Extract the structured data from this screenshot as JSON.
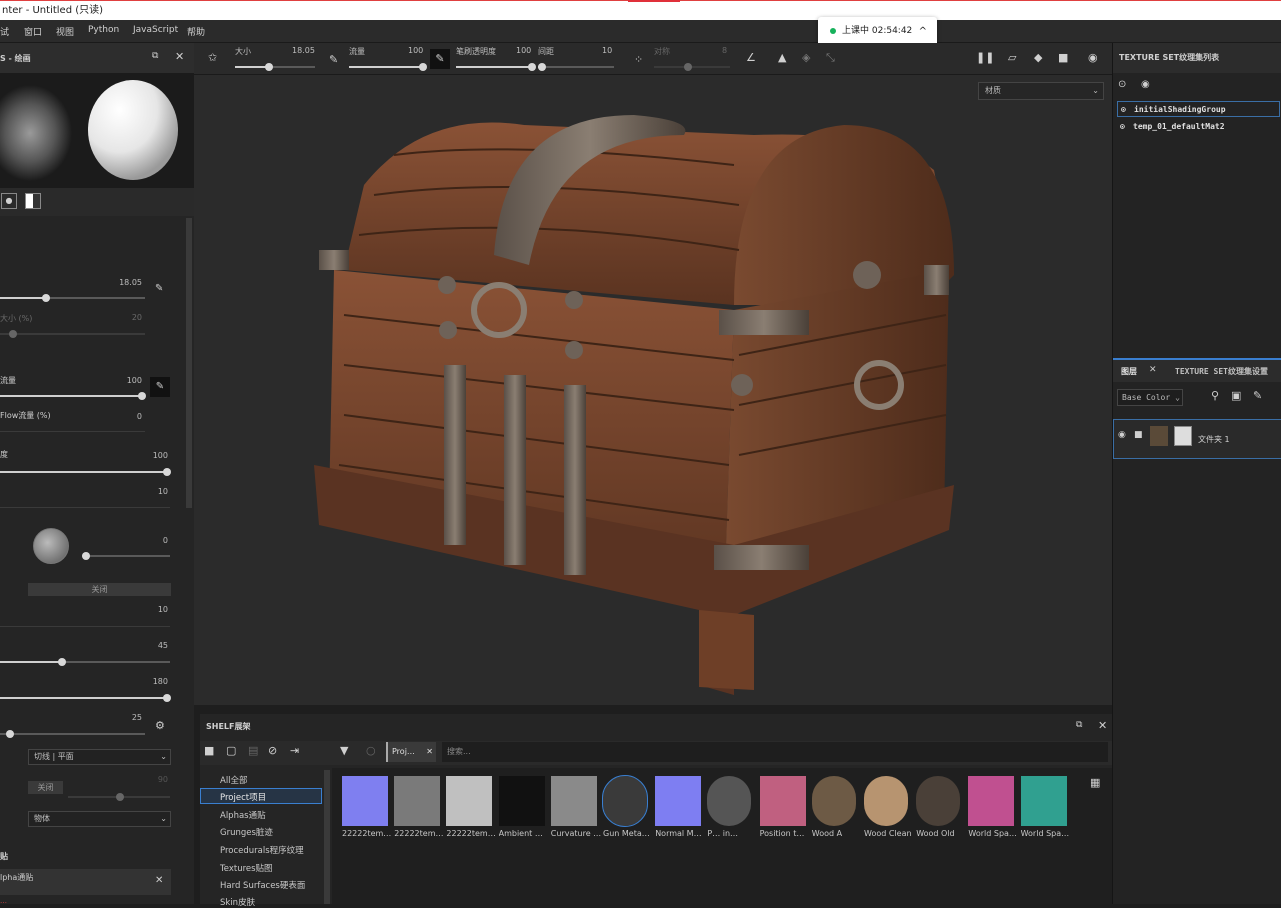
{
  "window": {
    "title": "nter - Untitled (只读)"
  },
  "menu": {
    "items": [
      "试",
      "窗口",
      "视图",
      "Python",
      "JavaScript",
      "帮助"
    ]
  },
  "live_badge": {
    "text": "上课中 02:54:42",
    "chevron": "^"
  },
  "left_panel": {
    "title": "S - 绘画",
    "rows": [
      {
        "label": "",
        "value": "18.05"
      },
      {
        "label": "大小 (%)",
        "value": "20"
      },
      {
        "label": "流量",
        "value": "100"
      },
      {
        "label": "Flow流量 (%)",
        "value": "0"
      },
      {
        "label": "度",
        "value": "100"
      },
      {
        "label": "",
        "value": "10"
      },
      {
        "label": "",
        "value": "0"
      },
      {
        "label": "",
        "value": "10"
      },
      {
        "label": "",
        "value": "45"
      },
      {
        "label": "",
        "value": "180"
      },
      {
        "label": "",
        "value": "25"
      }
    ],
    "close_button": "关闭",
    "mode_dropdown": "切线 | 平面",
    "close_button_2": "关闭",
    "dim_value": "90",
    "object_dropdown": "物体",
    "section_title": "贴",
    "alpha_item": "lpha通贴"
  },
  "toolbar": {
    "size_label": "大小",
    "size_value": "18.05",
    "flow_label": "流量",
    "flow_value": "100",
    "stroke_opacity_label": "笔刷透明度",
    "stroke_opacity_value": "100",
    "spacing_label": "间距",
    "spacing_value": "10",
    "sym_label": "对称",
    "sym_value": "8"
  },
  "viewport": {
    "material_dropdown": "材质"
  },
  "right_panel": {
    "texture_set_list_title": "TEXTURE SET纹理集列表",
    "texture_sets": [
      "initialShadingGroup",
      "temp_01_defaultMat2"
    ],
    "layers_tab": "图层",
    "texture_set_settings_tab": "TEXTURE SET纹理集设置",
    "channel_dropdown": "Base Color",
    "folder_layer_name": "文件夹 1"
  },
  "shelf": {
    "title": "SHELF展架",
    "filter_chip": "Proj…",
    "search_placeholder": "搜索...",
    "categories": [
      "All全部",
      "Project项目",
      "Alphas通贴",
      "Grunges脏迹",
      "Procedurals程序纹理",
      "Textures贴图",
      "Hard Surfaces硬表面",
      "Skin皮肤"
    ],
    "selected_category": "Project项目",
    "items": [
      {
        "label": "22222tem…",
        "color": "#7f7ff0"
      },
      {
        "label": "22222tem…",
        "color": "#7a7a7a"
      },
      {
        "label": "22222tem…",
        "color": "#c0c0c0"
      },
      {
        "label": "Ambient …",
        "color": "#111111"
      },
      {
        "label": "Curvature …",
        "color": "#8a8a8a"
      },
      {
        "label": "Gun Meta…",
        "color": "#3a3a3a"
      },
      {
        "label": "Normal M…",
        "color": "#7e7ef2"
      },
      {
        "label": "P… in…",
        "color": "#555555"
      },
      {
        "label": "Position t…",
        "color": "#c06080"
      },
      {
        "label": "Wood A",
        "color": "#6d5a45"
      },
      {
        "label": "Wood Clean",
        "color": "#b79470"
      },
      {
        "label": "Wood Old",
        "color": "#4a4038"
      },
      {
        "label": "World Spa…",
        "color": "#c05090"
      },
      {
        "label": "World Spa…",
        "color": "#30a090"
      }
    ]
  },
  "status": {
    "warning": "…"
  }
}
